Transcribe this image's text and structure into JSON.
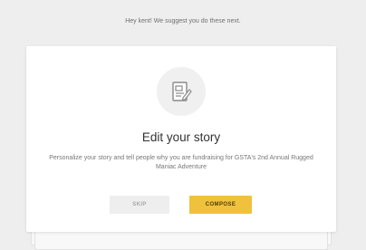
{
  "intro": {
    "text": "Hey kent! We suggest you do these next."
  },
  "card": {
    "icon": "edit-document-icon",
    "title": "Edit your story",
    "description": "Personalize your story and tell people why you are fundraising for GSTA's 2nd Annual Rugged Maniac Adventure",
    "skip_label": "SKIP",
    "compose_label": "COMPOSE"
  },
  "colors": {
    "page_background": "#eeeeee",
    "card_background": "#ffffff",
    "accent": "#f0c13c",
    "skip_background": "#eeeeee"
  }
}
